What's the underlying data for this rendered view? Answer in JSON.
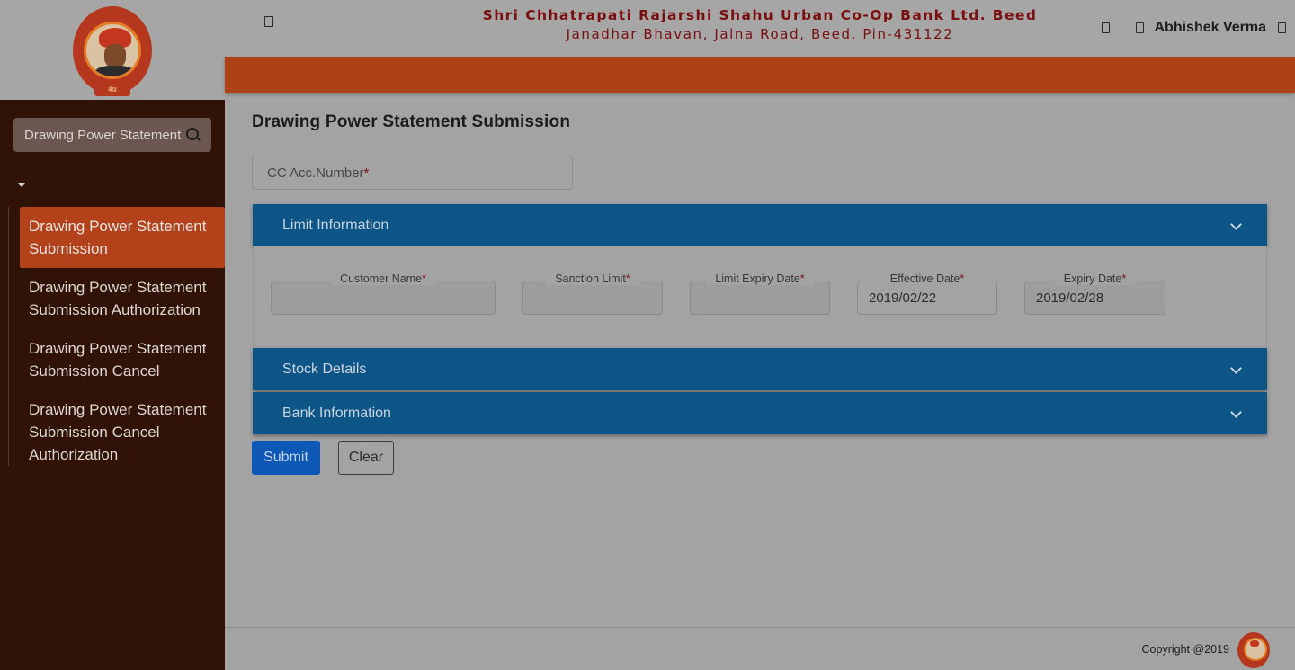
{
  "sidebar": {
    "logo_text": "बीड",
    "search_value": "Drawing Power Statement",
    "items": [
      {
        "label": "Drawing Power Statement Submission",
        "active": true
      },
      {
        "label": "Drawing Power Statement Submission Authorization",
        "active": false
      },
      {
        "label": "Drawing Power Statement Submission Cancel",
        "active": false
      },
      {
        "label": "Drawing Power Statement Submission Cancel Authorization",
        "active": false
      }
    ]
  },
  "header": {
    "bank_name": "Shri Chhatrapati Rajarshi Shahu Urban Co-Op Bank Ltd. Beed",
    "bank_address": "Janadhar Bhavan, Jalna Road, Beed. Pin-431122",
    "user_name": "Abhishek Verma"
  },
  "main": {
    "page_title": "Drawing Power Statement Submission",
    "cc_acc_placeholder": "CC Acc.Number",
    "required_mark": "*",
    "panels": {
      "limit": "Limit Information",
      "stock": "Stock Details",
      "bank": "Bank Information"
    },
    "fields": {
      "customer_name": {
        "label": "Customer Name",
        "value": ""
      },
      "sanction_limit": {
        "label": "Sanction Limit",
        "value": ""
      },
      "limit_expiry_date": {
        "label": "Limit Expiry Date",
        "value": ""
      },
      "effective_date": {
        "label": "Effective Date",
        "value": "2019/02/22"
      },
      "expiry_date": {
        "label": "Expiry Date",
        "value": "2019/02/28"
      }
    },
    "buttons": {
      "submit": "Submit",
      "clear": "Clear"
    }
  },
  "footer": {
    "copyright": "Copyright @2019"
  }
}
